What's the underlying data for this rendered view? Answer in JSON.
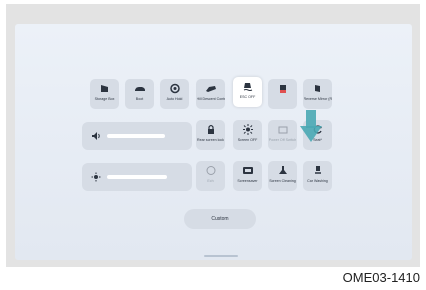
{
  "tiles_row1": [
    {
      "label": "Storage Box",
      "icon": "storage-box-icon"
    },
    {
      "label": "Boot",
      "icon": "car-icon"
    },
    {
      "label": "Auto Hold",
      "icon": "auto-hold-icon"
    },
    {
      "label": "Hill Descent Control",
      "icon": "hill-descent-icon"
    },
    {
      "label": "ESC OFF",
      "icon": "esc-off-icon",
      "active": true
    },
    {
      "label": "",
      "icon": "battery-icon"
    },
    {
      "label": "Reverse Mirror (Re...",
      "icon": "mirror-icon"
    }
  ],
  "tiles_row2": [
    {
      "label": "Rear screen lock",
      "icon": "lock-icon"
    },
    {
      "label": "Screen OFF",
      "icon": "screen-off-icon"
    },
    {
      "label": "Power Off Switch",
      "icon": "power-switch-icon",
      "dim": true
    },
    {
      "label": "Seat*",
      "icon": "refresh-icon"
    }
  ],
  "tiles_row3": [
    {
      "label": "Ech",
      "icon": "eco-icon",
      "dim": true
    },
    {
      "label": "Screensaver",
      "icon": "screensaver-icon"
    },
    {
      "label": "Screen Cleaning",
      "icon": "screen-cleaning-icon"
    },
    {
      "label": "Car Washing",
      "icon": "car-wash-icon"
    }
  ],
  "sliders": {
    "volume": {
      "icon": "volume-icon",
      "level": 0.65
    },
    "brightness": {
      "icon": "brightness-icon",
      "level": 0.7
    }
  },
  "custom_button": "Custom",
  "caption": "OME03-1410",
  "colors": {
    "tile": "#d6dce5",
    "screen": "#e8edf5",
    "arrow": "#4aa8b4"
  }
}
